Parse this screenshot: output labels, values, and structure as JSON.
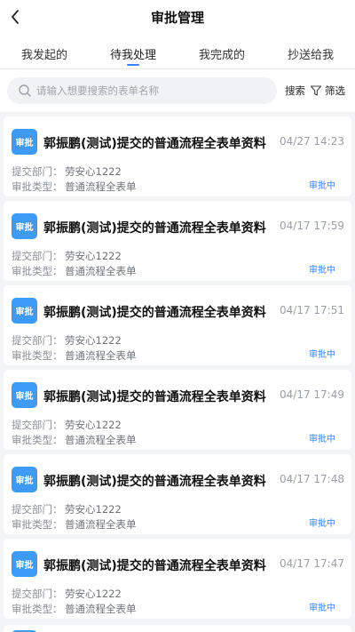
{
  "header": {
    "title": "审批管理",
    "back_icon": "chevron-left-icon"
  },
  "tabs": [
    {
      "label": "我发起的",
      "active": false
    },
    {
      "label": "待我处理",
      "active": true
    },
    {
      "label": "我完成的",
      "active": false
    },
    {
      "label": "抄送给我",
      "active": false
    }
  ],
  "search": {
    "placeholder": "请输入想要搜索的表单名称",
    "button_label": "搜索",
    "filter_label": "筛选"
  },
  "accent_color": "#3b82f6",
  "items": [
    {
      "icon_text": "审批",
      "title": "郭振鹏(测试)提交的普通流程全表单资料",
      "time": "04/27 14:23",
      "dept_label": "提交部门：",
      "dept": "劳安心1222",
      "type_label": "审批类型：",
      "type": "普通流程全表单",
      "status": "审批中"
    },
    {
      "icon_text": "审批",
      "title": "郭振鹏(测试)提交的普通流程全表单资料",
      "time": "04/17 17:59",
      "dept_label": "提交部门：",
      "dept": "劳安心1222",
      "type_label": "审批类型：",
      "type": "普通流程全表单",
      "status": "审批中"
    },
    {
      "icon_text": "审批",
      "title": "郭振鹏(测试)提交的普通流程全表单资料",
      "time": "04/17 17:51",
      "dept_label": "提交部门：",
      "dept": "劳安心1222",
      "type_label": "审批类型：",
      "type": "普通流程全表单",
      "status": "审批中"
    },
    {
      "icon_text": "审批",
      "title": "郭振鹏(测试)提交的普通流程全表单资料",
      "time": "04/17 17:49",
      "dept_label": "提交部门：",
      "dept": "劳安心1222",
      "type_label": "审批类型：",
      "type": "普通流程全表单",
      "status": "审批中"
    },
    {
      "icon_text": "审批",
      "title": "郭振鹏(测试)提交的普通流程全表单资料",
      "time": "04/17 17:48",
      "dept_label": "提交部门：",
      "dept": "劳安心1222",
      "type_label": "审批类型：",
      "type": "普通流程全表单",
      "status": "审批中"
    },
    {
      "icon_text": "审批",
      "title": "郭振鹏(测试)提交的普通流程全表单资料",
      "time": "04/17 17:47",
      "dept_label": "提交部门：",
      "dept": "劳安心1222",
      "type_label": "审批类型：",
      "type": "普通流程全表单",
      "status": "审批中"
    }
  ]
}
